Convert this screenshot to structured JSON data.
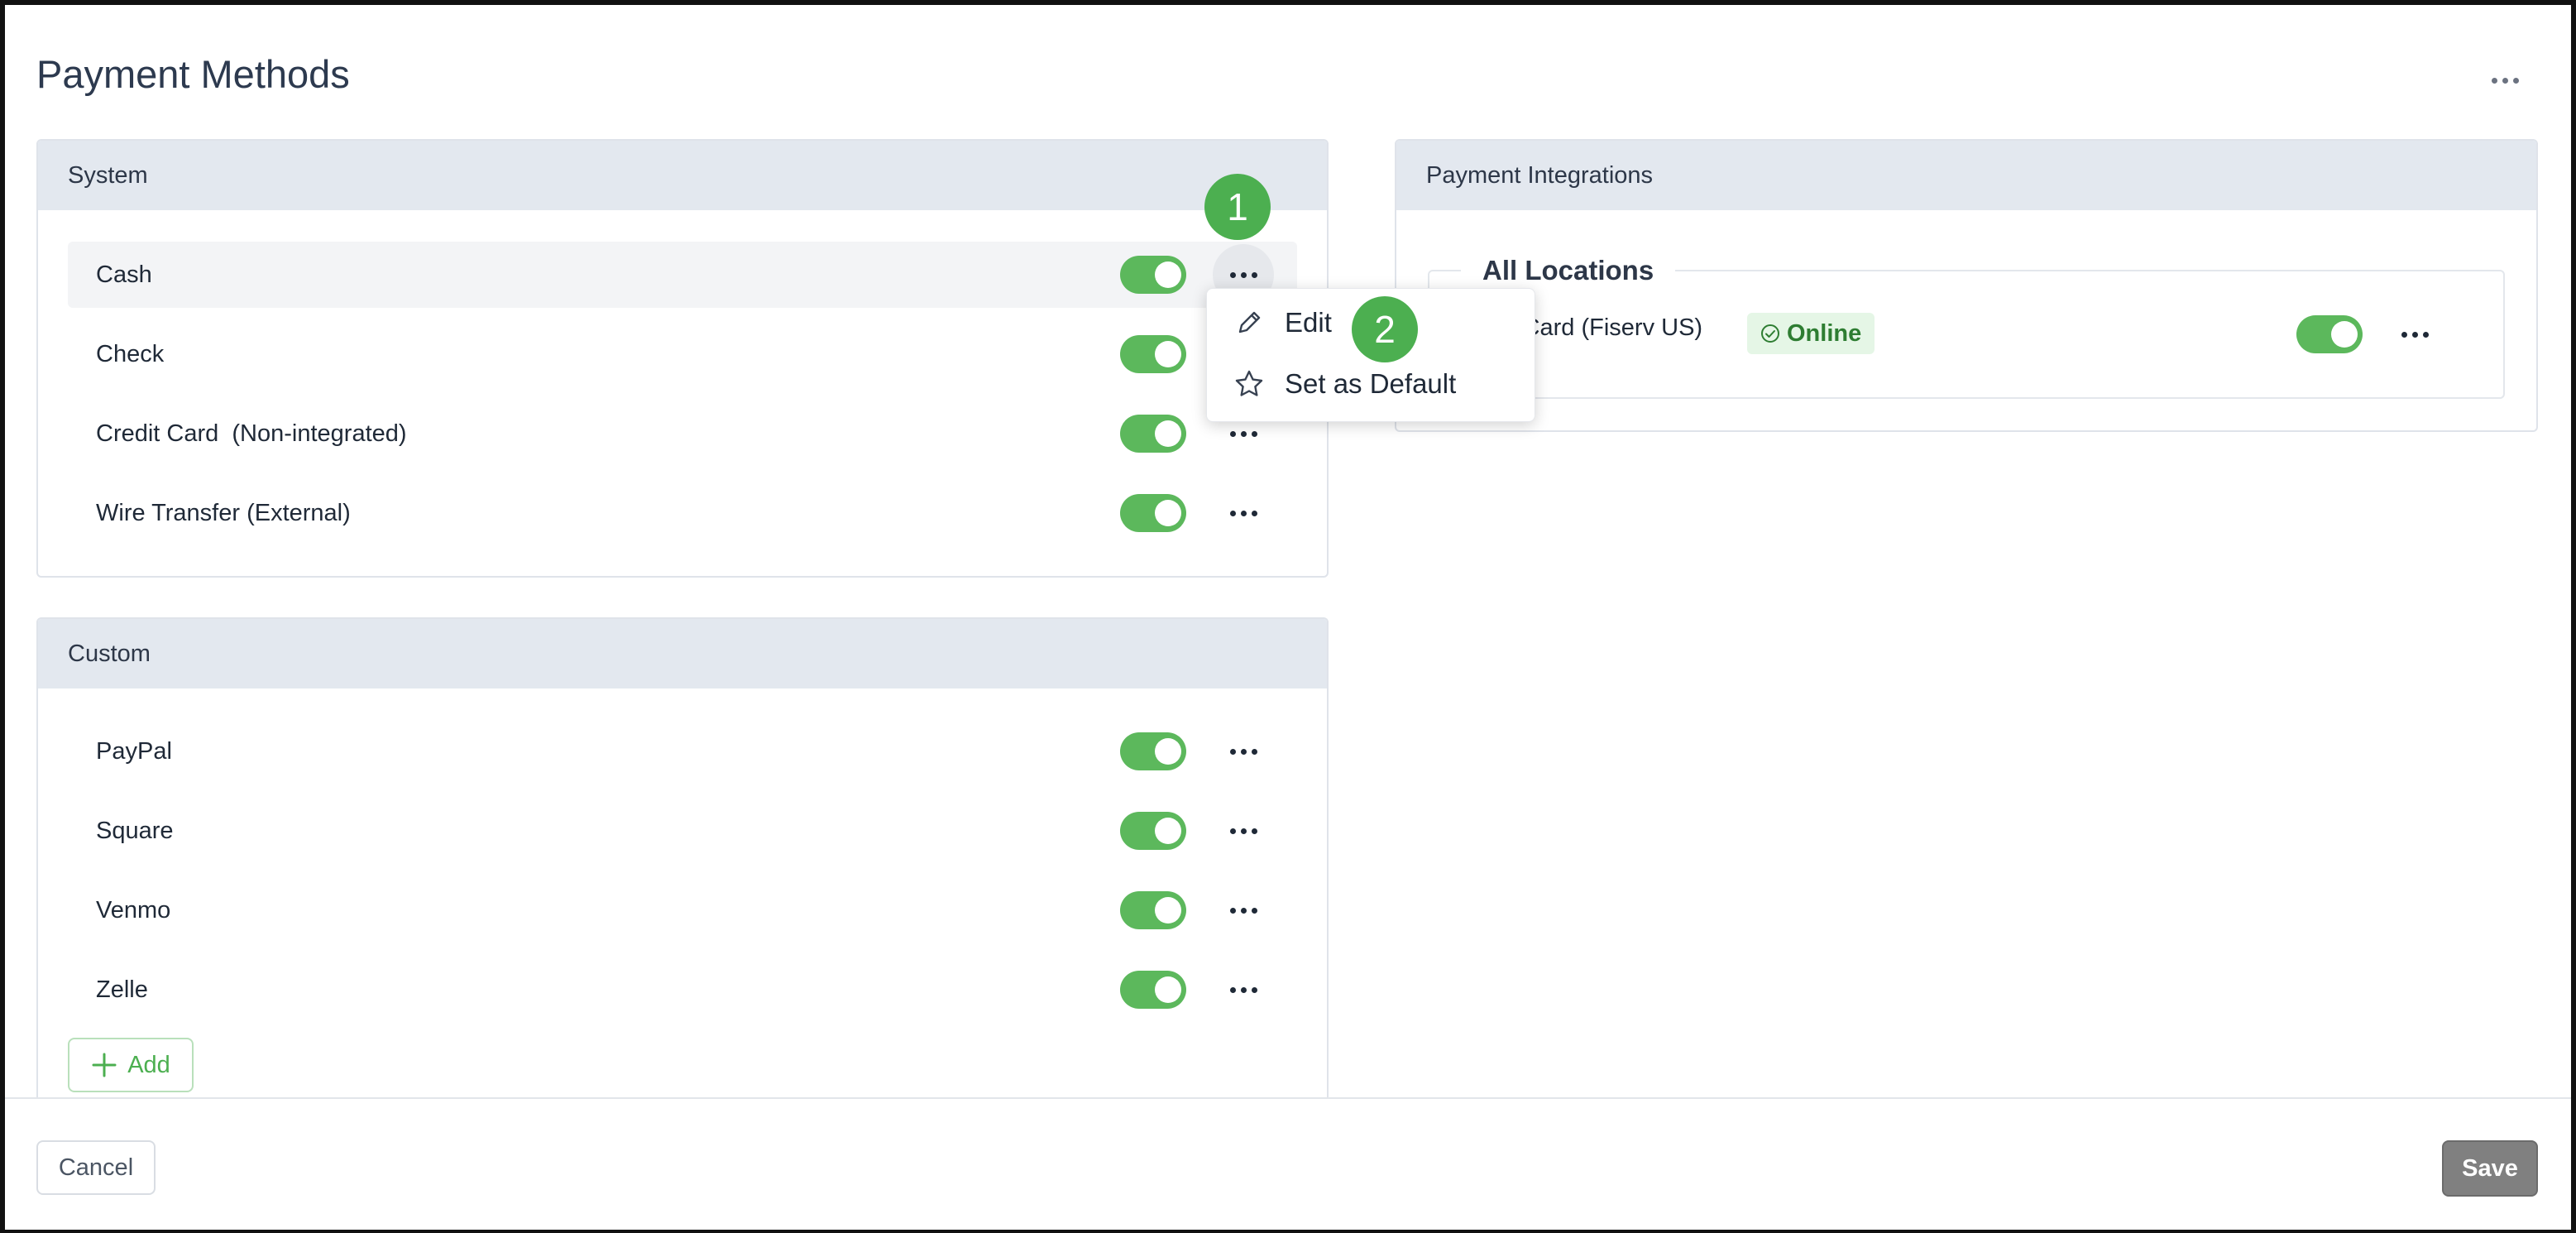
{
  "page": {
    "title": "Payment Methods"
  },
  "system": {
    "title": "System",
    "items": [
      {
        "label": "Cash",
        "enabled": true
      },
      {
        "label": "Check",
        "enabled": true
      },
      {
        "label": "Credit Card  (Non-integrated)",
        "enabled": true
      },
      {
        "label": "Wire Transfer (External)",
        "enabled": true
      }
    ]
  },
  "custom": {
    "title": "Custom",
    "items": [
      {
        "label": "PayPal",
        "enabled": true
      },
      {
        "label": "Square",
        "enabled": true
      },
      {
        "label": "Venmo",
        "enabled": true
      },
      {
        "label": "Zelle",
        "enabled": true
      }
    ],
    "add_label": "Add"
  },
  "integrations": {
    "title": "Payment Integrations",
    "group_label": "All Locations",
    "item": {
      "label": "it Card (Fiserv US)",
      "status": "Online",
      "enabled": true
    }
  },
  "context_menu": {
    "items": [
      {
        "label": "Edit",
        "icon": "pencil-icon"
      },
      {
        "label": "Set as Default",
        "icon": "star-icon"
      }
    ]
  },
  "steps": [
    "1",
    "2"
  ],
  "footer": {
    "cancel_label": "Cancel",
    "save_label": "Save"
  },
  "colors": {
    "accent": "#4caf50",
    "toggle_on": "#5cb85c",
    "badge_bg": "#e5f6e6",
    "panel_header": "#e3e8ef"
  }
}
